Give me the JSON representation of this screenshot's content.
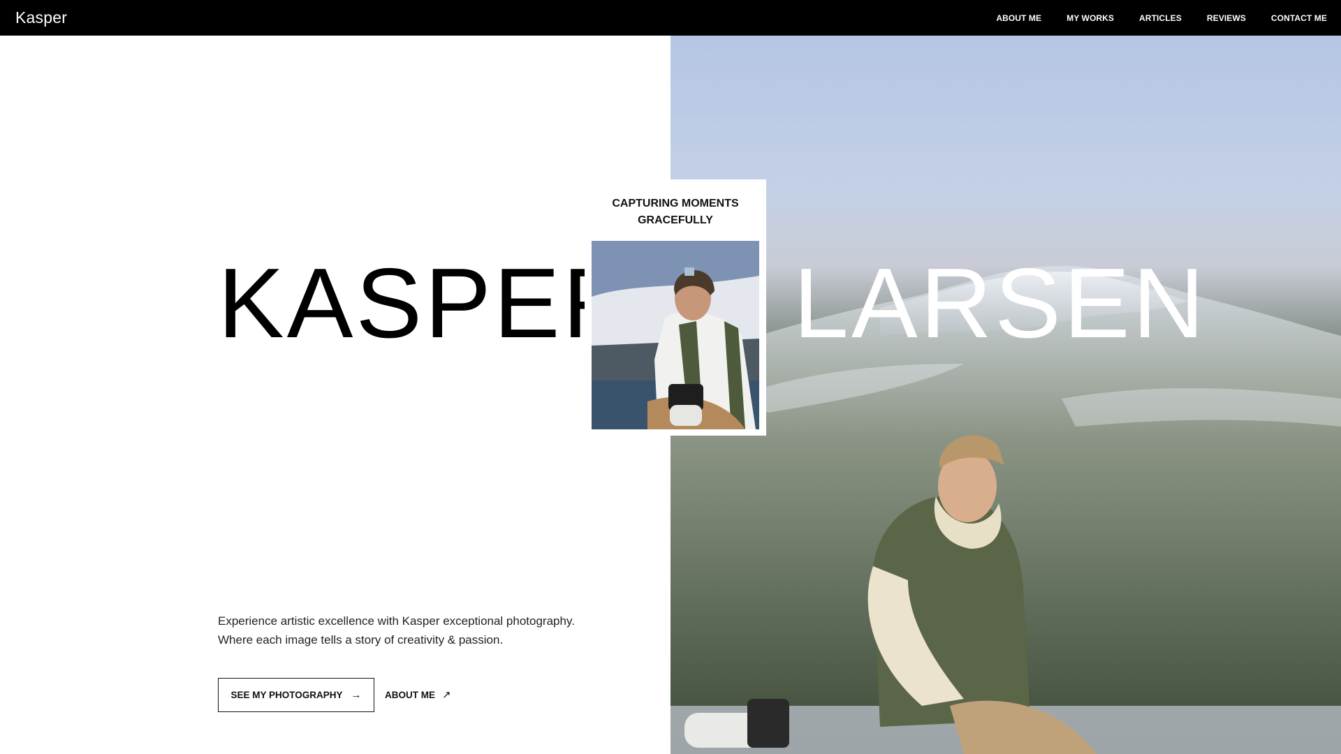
{
  "nav": {
    "logo": "Kasper",
    "links": [
      {
        "label": "ABOUT ME"
      },
      {
        "label": "MY WORKS"
      },
      {
        "label": "ARTICLES"
      },
      {
        "label": "REVIEWS"
      },
      {
        "label": "CONTACT ME"
      }
    ]
  },
  "hero": {
    "first_name": "KASPER",
    "last_name": "LARSEN",
    "tagline": "CAPTURING MOMENTS GRACEFULLY",
    "intro": "Experience artistic excellence with Kasper exceptional photography. Where each image tells a story of creativity & passion.",
    "primary_cta": "SEE MY PHOTOGRAPHY",
    "primary_cta_icon": "arrow-right-icon",
    "secondary_cta": "ABOUT ME",
    "secondary_cta_icon": "arrow-up-right-icon"
  },
  "colors": {
    "nav_background": "#000000",
    "page_background": "#ffffff",
    "text": "#111111"
  }
}
